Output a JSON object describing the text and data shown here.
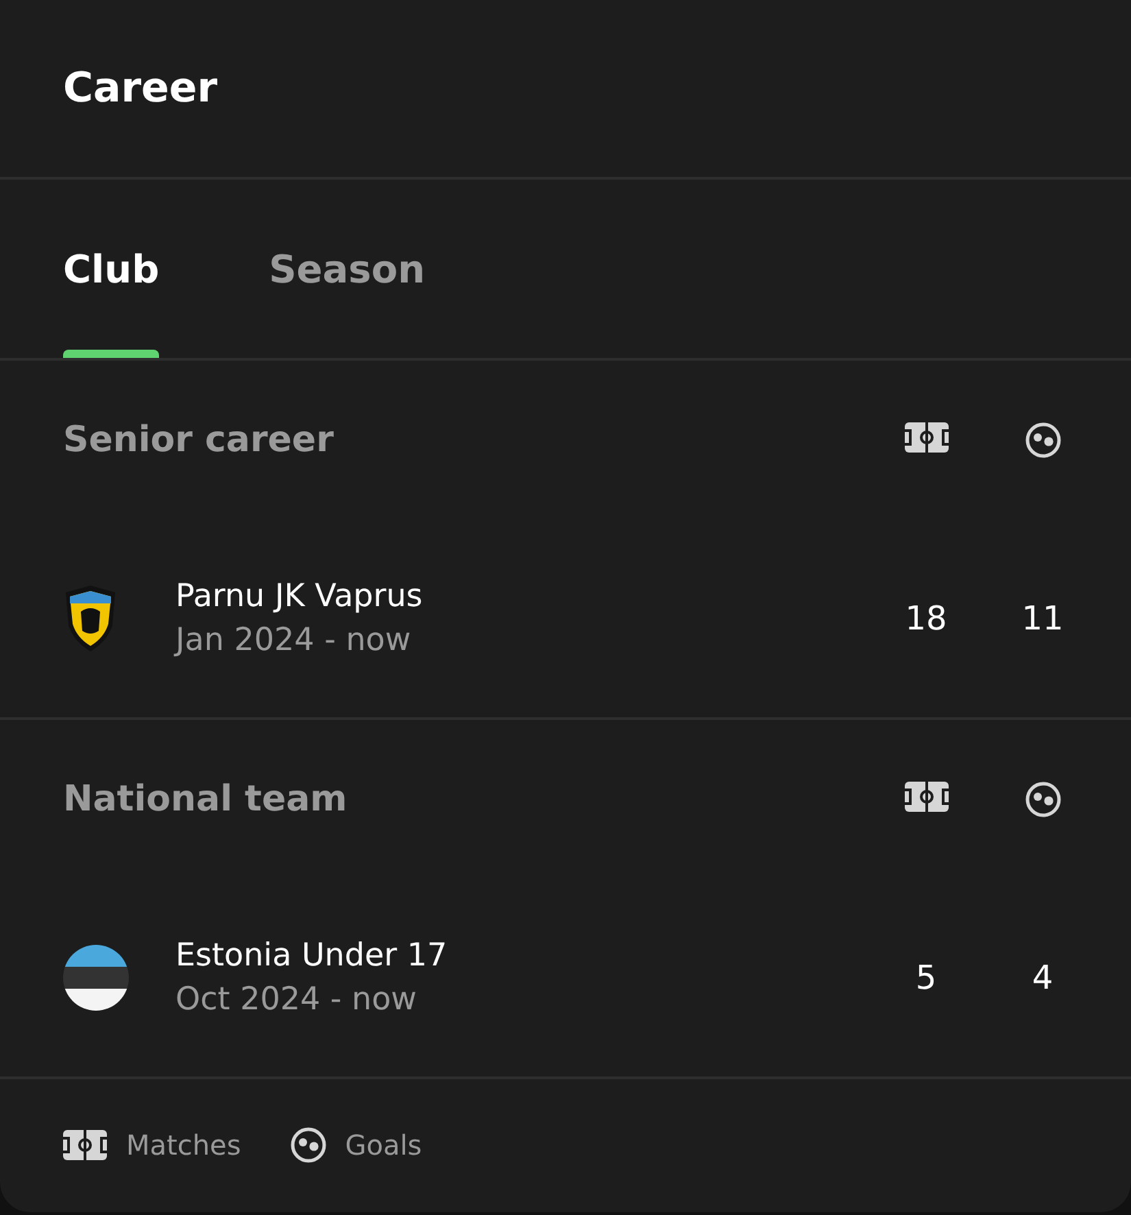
{
  "title": "Career",
  "tabs": [
    {
      "label": "Club",
      "selected": true
    },
    {
      "label": "Season",
      "selected": false
    }
  ],
  "sections": [
    {
      "title": "Senior career",
      "entries": [
        {
          "kind": "crest",
          "name": "Parnu JK Vaprus",
          "period": "Jan 2024 - now",
          "matches": "18",
          "goals": "11"
        }
      ]
    },
    {
      "title": "National team",
      "entries": [
        {
          "kind": "flag",
          "name": "Estonia Under 17",
          "period": "Oct 2024 - now",
          "matches": "5",
          "goals": "4"
        }
      ]
    }
  ],
  "legend": {
    "matches": "Matches",
    "goals": "Goals"
  }
}
